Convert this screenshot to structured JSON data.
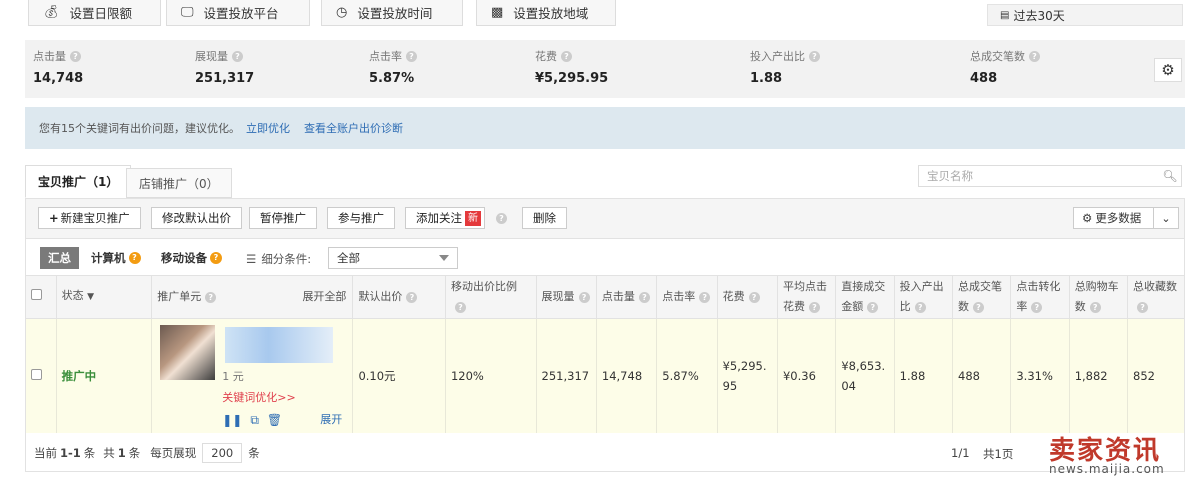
{
  "top_actions": [
    {
      "label": "设置日限额",
      "icon": "money-bag-icon"
    },
    {
      "label": "设置投放平台",
      "icon": "monitor-icon"
    },
    {
      "label": "设置投放时间",
      "icon": "clock-icon"
    },
    {
      "label": "设置投放地域",
      "icon": "map-icon"
    }
  ],
  "date_range": "过去30天",
  "metrics": [
    {
      "label": "点击量",
      "value": "14,748"
    },
    {
      "label": "展现量",
      "value": "251,317"
    },
    {
      "label": "点击率",
      "value": "5.87%"
    },
    {
      "label": "花费",
      "value": "¥5,295.95"
    },
    {
      "label": "投入产出比",
      "value": "1.88"
    },
    {
      "label": "总成交笔数",
      "value": "488"
    }
  ],
  "notice": {
    "text": "您有15个关键词有出价问题，建议优化。",
    "link1": "立即优化",
    "link2": "查看全账户出价诊断"
  },
  "tabs": [
    {
      "label": "宝贝推广（1）",
      "active": true
    },
    {
      "label": "店铺推广（0）",
      "active": false
    }
  ],
  "search": {
    "placeholder": "宝贝名称"
  },
  "toolbar": {
    "new_label": "新建宝贝推广",
    "modify_bid": "修改默认出价",
    "pause": "暂停推广",
    "join": "参与推广",
    "follow": "添加关注",
    "new_badge": "新",
    "delete": "删除",
    "more_data": "更多数据"
  },
  "filter": {
    "summary": "汇总",
    "computer": "计算机",
    "mobile": "移动设备",
    "sub_condition": "细分条件:",
    "select_value": "全部"
  },
  "table": {
    "headers": {
      "status": "状态",
      "unit": "推广单元",
      "expand_all": "展开全部",
      "default_bid": "默认出价",
      "mobile_ratio": "移动出价比例",
      "impressions": "展现量",
      "clicks": "点击量",
      "ctr": "点击率",
      "cost": "花费",
      "avg_cpc": "平均点击花费",
      "direct_gmv": "直接成交金额",
      "roi": "投入产出比",
      "total_orders": "总成交笔数",
      "cvr": "点击转化率",
      "cart": "总购物车数",
      "fav": "总收藏数"
    },
    "row": {
      "status": "推广中",
      "unit_partial": "1  元",
      "kw_optimize": "关键词优化>>",
      "expand": "展开",
      "default_bid": "0.10元",
      "mobile_ratio": "120%",
      "impressions": "251,317",
      "clicks": "14,748",
      "ctr": "5.87%",
      "cost": "¥5,295.95",
      "avg_cpc": "¥0.36",
      "direct_gmv": "¥8,653.04",
      "roi": "1.88",
      "total_orders": "488",
      "cvr": "3.31%",
      "cart": "1,882",
      "fav": "852"
    }
  },
  "pager": {
    "current": "当前",
    "range": "1-1",
    "unit": "条",
    "total": "共",
    "total_num": "1",
    "total_unit": "条",
    "per_page": "每页展现",
    "per_page_value": "200",
    "per_unit": "条",
    "page_info": "1/1",
    "total_pages": "共1页"
  },
  "watermark": {
    "main": "卖家资讯",
    "sub": "news.maijia.com"
  }
}
